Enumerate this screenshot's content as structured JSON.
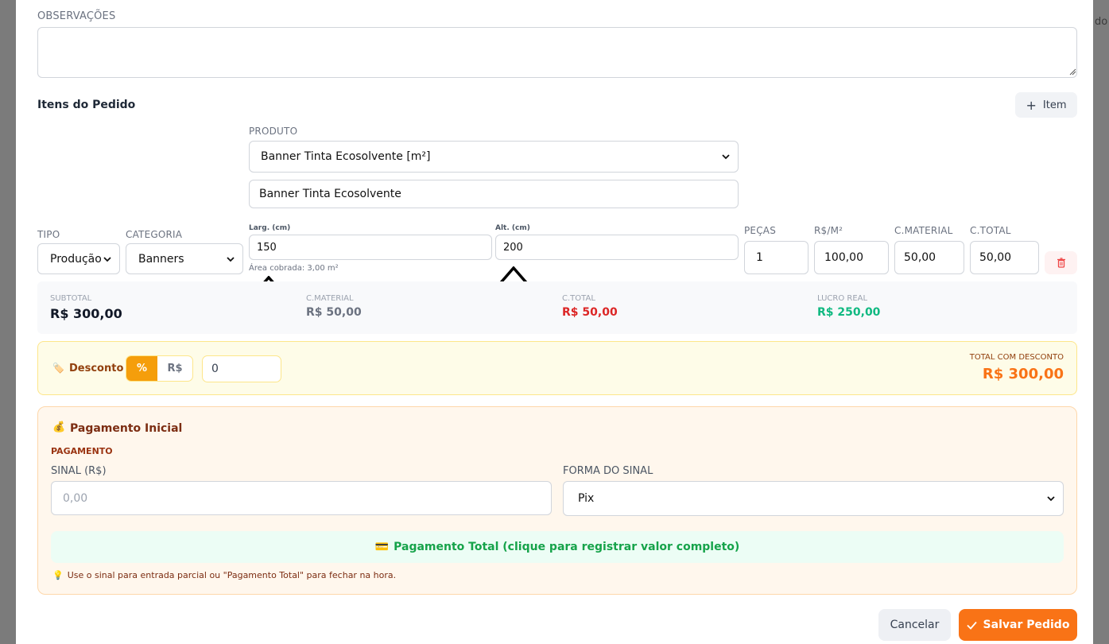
{
  "backdrop": {
    "edge_text": "do"
  },
  "observacoes": {
    "label": "OBSERVAÇÕES",
    "value": ""
  },
  "items": {
    "title": "Itens do Pedido",
    "add_button": {
      "icon": "+",
      "label": "Item"
    },
    "produto": {
      "label": "PRODUTO",
      "selected": "Banner Tinta Ecosolvente [m²]",
      "name_value": "Banner Tinta Ecosolvente"
    },
    "tipo": {
      "label": "TIPO",
      "selected": "Produção"
    },
    "categoria": {
      "label": "CATEGORIA",
      "selected": "Banners"
    },
    "largura": {
      "label": "Larg. (cm)",
      "value": "150"
    },
    "altura": {
      "label": "Alt. (cm)",
      "value": "200"
    },
    "area_note": "Área cobrada: 3,00 m²",
    "pecas": {
      "label": "PEÇAS",
      "value": "1"
    },
    "rs_m2": {
      "label": "R$/M²",
      "value": "100,00"
    },
    "c_material": {
      "label": "C.MATERIAL",
      "value": "50,00"
    },
    "c_total": {
      "label": "C.TOTAL",
      "value": "50,00"
    }
  },
  "summary": {
    "subtotal": {
      "label": "SUBTOTAL",
      "value": "R$ 300,00"
    },
    "c_material": {
      "label": "C.MATERIAL",
      "value": "R$ 50,00"
    },
    "c_total": {
      "label": "C.TOTAL",
      "value": "R$ 50,00"
    },
    "lucro": {
      "label": "LUCRO REAL",
      "value": "R$ 250,00"
    }
  },
  "desconto": {
    "icon": "🏷️",
    "label": "Desconto",
    "toggle": [
      "%",
      "R$"
    ],
    "active": "%",
    "value": "0",
    "total_label": "TOTAL COM DESCONTO",
    "total_value": "R$ 300,00"
  },
  "pagamento": {
    "icon": "💰",
    "title": "Pagamento Inicial",
    "subtitle": "PAGAMENTO",
    "sinal_label": "SINAL (R$)",
    "sinal_placeholder": "0,00",
    "forma_label": "FORMA DO SINAL",
    "forma_selected": "Pix",
    "total_button_icon": "💳",
    "total_button": "Pagamento Total (clique para registrar valor completo)",
    "hint_icon": "💡",
    "hint": "Use o sinal para entrada parcial ou \"Pagamento Total\" para fechar na hora."
  },
  "footer": {
    "cancel": "Cancelar",
    "save": "Salvar Pedido"
  },
  "colors": {
    "accent": "#f97316",
    "red": "#dc2626",
    "green": "#10b981",
    "discount_text": "#92400e"
  }
}
